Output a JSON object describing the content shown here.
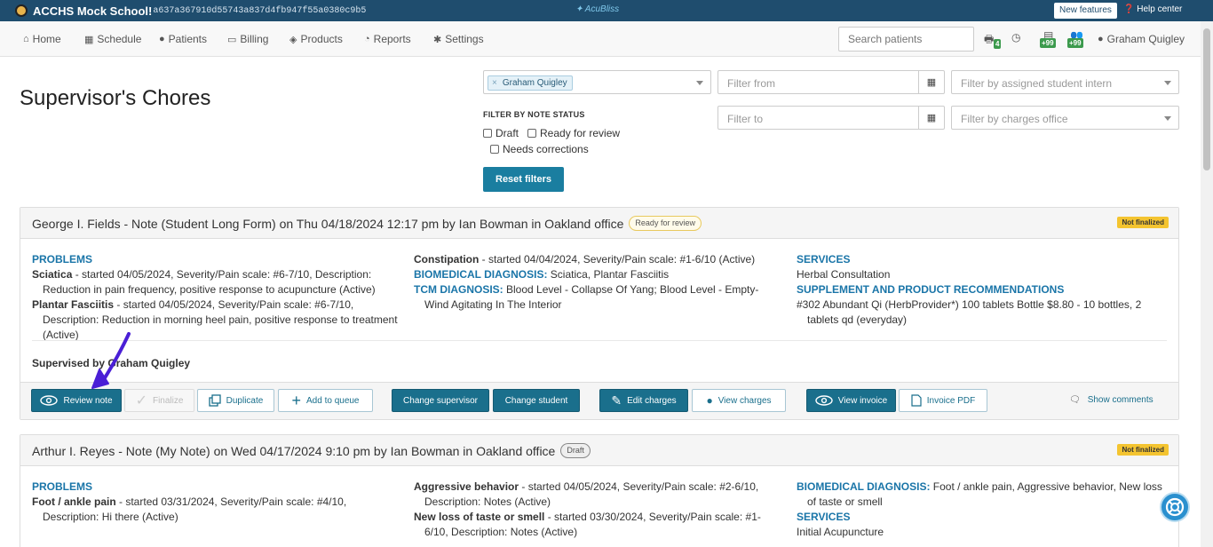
{
  "topbar": {
    "school": "ACCHS Mock School!",
    "hash": "a637a367910d55743a837d4fb947f55a0380c9b5",
    "brand": "AcuBliss",
    "new_features": "New features",
    "help_center": "Help center"
  },
  "nav": {
    "home": "Home",
    "schedule": "Schedule",
    "patients": "Patients",
    "billing": "Billing",
    "products": "Products",
    "reports": "Reports",
    "settings": "Settings",
    "search_placeholder": "Search patients",
    "inbox_count": "4",
    "badge1": "+99",
    "badge2": "+99",
    "user": "Graham Quigley"
  },
  "page": {
    "title": "Supervisor's Chores",
    "supervisor_tag": "Graham Quigley",
    "filter_from": "Filter from",
    "filter_to": "Filter to",
    "filter_intern": "Filter by assigned student intern",
    "filter_office": "Filter by charges office",
    "filter_status_label": "FILTER BY NOTE STATUS",
    "status_draft": "Draft",
    "status_ready": "Ready for review",
    "status_corrections": "Needs corrections",
    "reset": "Reset filters"
  },
  "note1": {
    "title": "George I. Fields - Note (Student Long Form) on Thu 04/18/2024 12:17 pm by Ian Bowman in Oakland office",
    "status": "Ready for review",
    "finalized": "Not finalized",
    "problems_title": "PROBLEMS",
    "p1_name": "Sciatica",
    "p1_desc": " - started 04/05/2024, Severity/Pain scale: #6-7/10, Description: Reduction in pain frequency, positive response to acupuncture (Active)",
    "p2_name": "Plantar Fasciitis",
    "p2_desc": " - started 04/05/2024, Severity/Pain scale: #6-7/10, Description: Reduction in morning heel pain, positive response to treatment (Active)",
    "p3_name": "Constipation",
    "p3_desc": " - started 04/04/2024, Severity/Pain scale: #1-6/10 (Active)",
    "bio_label": "BIOMEDICAL DIAGNOSIS:",
    "bio_value": " Sciatica, Plantar Fasciitis",
    "tcm_label": "TCM DIAGNOSIS:",
    "tcm_value": " Blood Level - Collapse Of Yang; Blood Level - Empty-Wind Agitating In The Interior",
    "services_title": "SERVICES",
    "services_value": "Herbal Consultation",
    "supp_title": "SUPPLEMENT AND PRODUCT RECOMMENDATIONS",
    "supp_value": "#302 Abundant Qi (HerbProvider*) 100 tablets Bottle $8.80 - 10 bottles, 2 tablets qd (everyday)",
    "supervised_by": "Supervised by Graham Quigley"
  },
  "actions": {
    "review": "Review note",
    "finalize": "Finalize",
    "duplicate": "Duplicate",
    "add_queue": "Add to queue",
    "change_supervisor": "Change supervisor",
    "change_student": "Change student",
    "edit_charges": "Edit charges",
    "view_charges": "View charges",
    "view_invoice": "View invoice",
    "invoice_pdf": "Invoice PDF",
    "show_comments": "Show comments"
  },
  "note2": {
    "title": "Arthur I. Reyes - Note (My Note) on Wed 04/17/2024 9:10 pm by Ian Bowman in Oakland office",
    "status": "Draft",
    "finalized": "Not finalized",
    "problems_title": "PROBLEMS",
    "p1_name": "Foot / ankle pain",
    "p1_desc": " - started 03/31/2024, Severity/Pain scale: #4/10, Description: Hi there (Active)",
    "p2_name": "Aggressive behavior",
    "p2_desc": " - started 04/05/2024, Severity/Pain scale: #2-6/10, Description: Notes (Active)",
    "p3_name": "New loss of taste or smell",
    "p3_desc": " - started 03/30/2024, Severity/Pain scale: #1-6/10, Description: Notes (Active)",
    "bio_label": "BIOMEDICAL DIAGNOSIS:",
    "bio_value": " Foot / ankle pain, Aggressive behavior, New loss of taste or smell",
    "services_title": "SERVICES",
    "services_value": "Initial Acupuncture"
  },
  "colors": {
    "primary": "#1a6f8c",
    "link": "#1a75a8",
    "topbar": "#1f4d6e",
    "warning": "#f4c430",
    "annotation_arrow": "#4a1fd6"
  }
}
